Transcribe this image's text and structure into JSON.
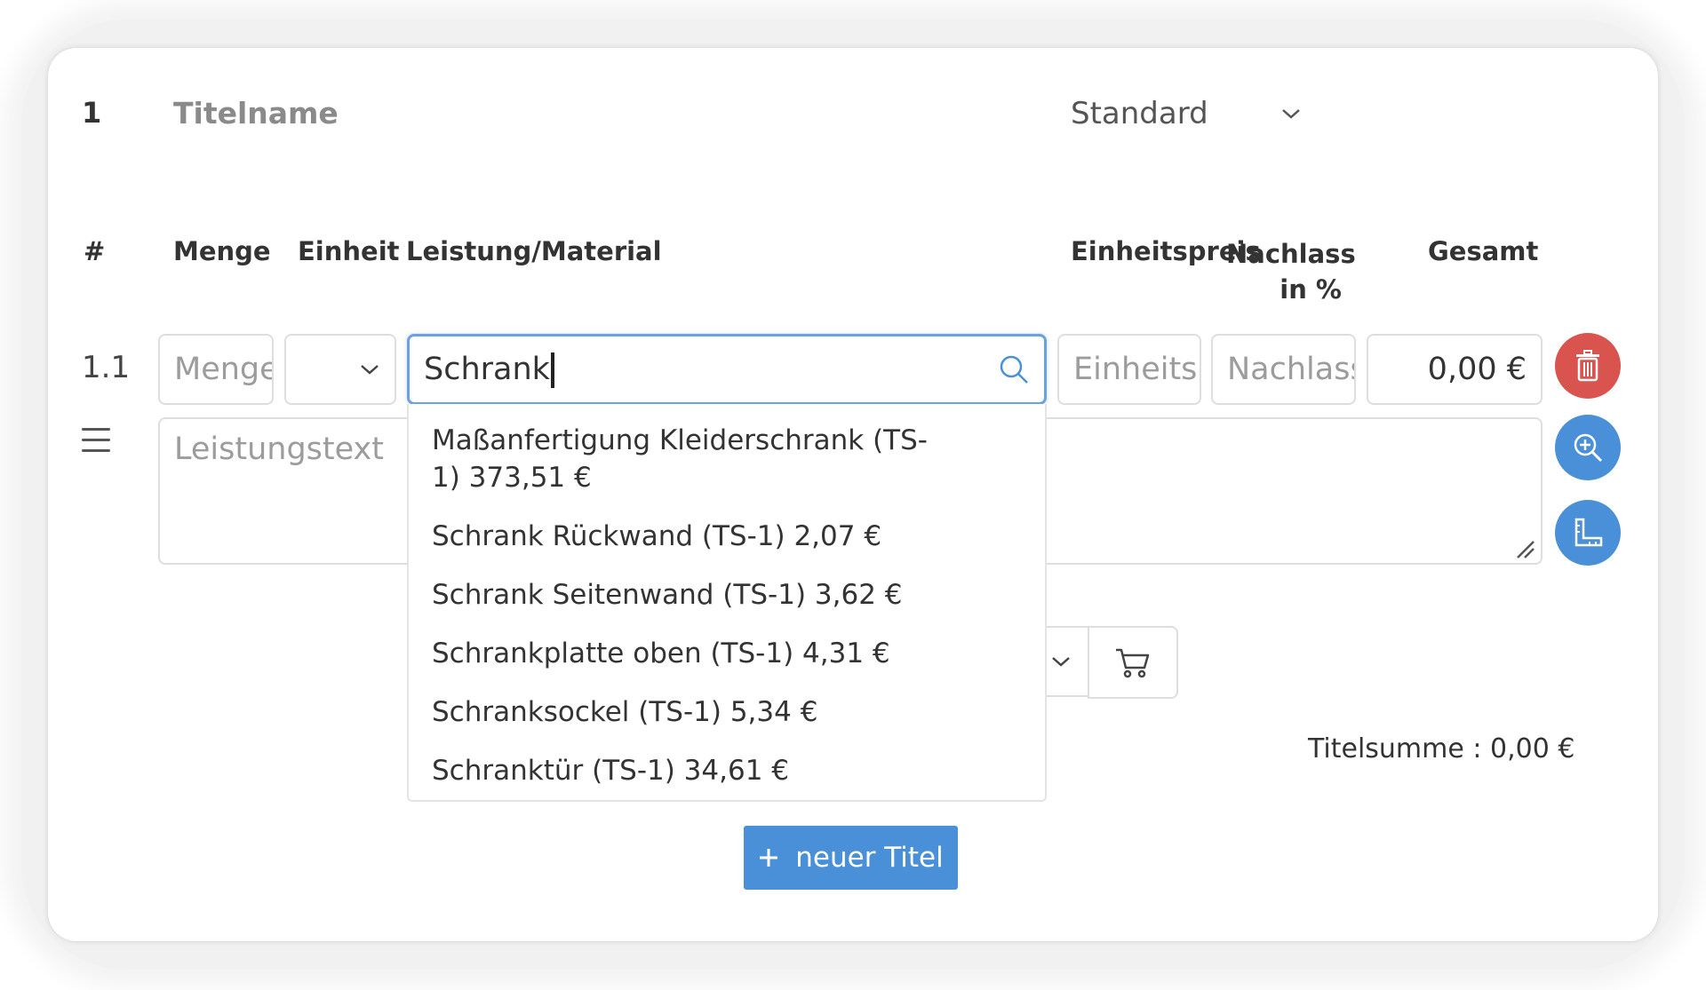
{
  "title": {
    "number": "1",
    "name_placeholder": "Titelname",
    "type_select": "Standard"
  },
  "columns": {
    "hash": "#",
    "menge": "Menge",
    "einheit": "Einheit",
    "leistung": "Leistung/Material",
    "einheitspreis": "Einheitspreis",
    "nachlass_line1": "Nachlass",
    "nachlass_line2": "in %",
    "gesamt": "Gesamt"
  },
  "row": {
    "position": "1.1",
    "menge_placeholder": "Menge",
    "einheit_value": "",
    "search_value": "Schrank",
    "einheitspreis_placeholder": "Einheitspreis",
    "nachlass_placeholder": "Nachlass",
    "gesamt_value": "0,00 €",
    "leistungstext_placeholder": "Leistungstext"
  },
  "suggestions": [
    "Maßanfertigung Kleiderschrank (TS-1) 373,51 €",
    "Schrank Rückwand (TS-1) 2,07 €",
    "Schrank Seitenwand (TS-1) 3,62 €",
    "Schrankplatte oben (TS-1) 4,31 €",
    "Schranksockel (TS-1) 5,34 €",
    "Schranktür (TS-1) 34,61 €"
  ],
  "footer": {
    "titelsumme": "Titelsumme : 0,00 €",
    "new_title_button": "neuer Titel"
  },
  "icons": {
    "delete": "trash-icon",
    "zoom": "zoom-in-icon",
    "measure": "ruler-icon",
    "cart": "cart-icon",
    "search": "search-icon",
    "drag": "menu-icon"
  },
  "colors": {
    "primary": "#4a90d9",
    "danger": "#d9534f",
    "focus_border": "#6aa3e0"
  }
}
